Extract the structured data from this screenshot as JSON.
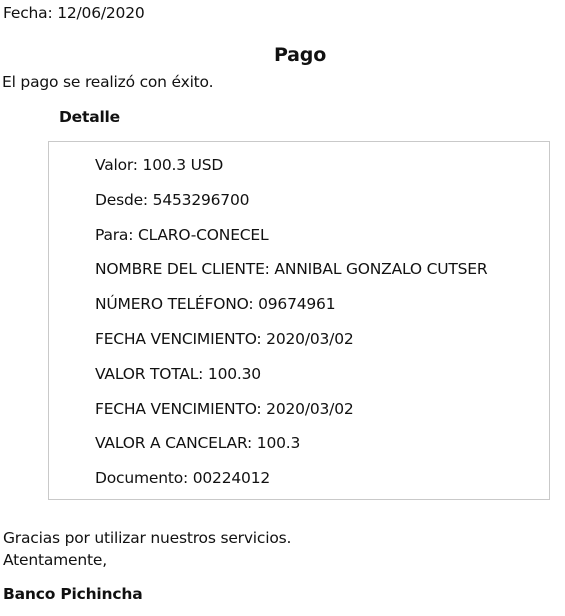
{
  "header": {
    "date_line": "Fecha: 12/06/2020"
  },
  "title": "Pago",
  "message": "El pago se realizó con éxito.",
  "detail": {
    "heading": "Detalle",
    "rows": [
      "Valor: 100.3 USD",
      "Desde: 5453296700",
      "Para: CLARO-CONECEL",
      "NOMBRE DEL CLIENTE: ANNIBAL GONZALO CUTSER",
      "NÚMERO TELÉFONO: 09674961",
      "FECHA VENCIMIENTO: 2020/03/02",
      "VALOR TOTAL: 100.30",
      "FECHA VENCIMIENTO: 2020/03/02",
      "VALOR A CANCELAR: 100.3",
      "Documento: 00224012"
    ]
  },
  "footer": {
    "thanks": "Gracias por utilizar nuestros servicios.",
    "regards": "Atentamente,",
    "signature": "Banco Pichincha"
  }
}
